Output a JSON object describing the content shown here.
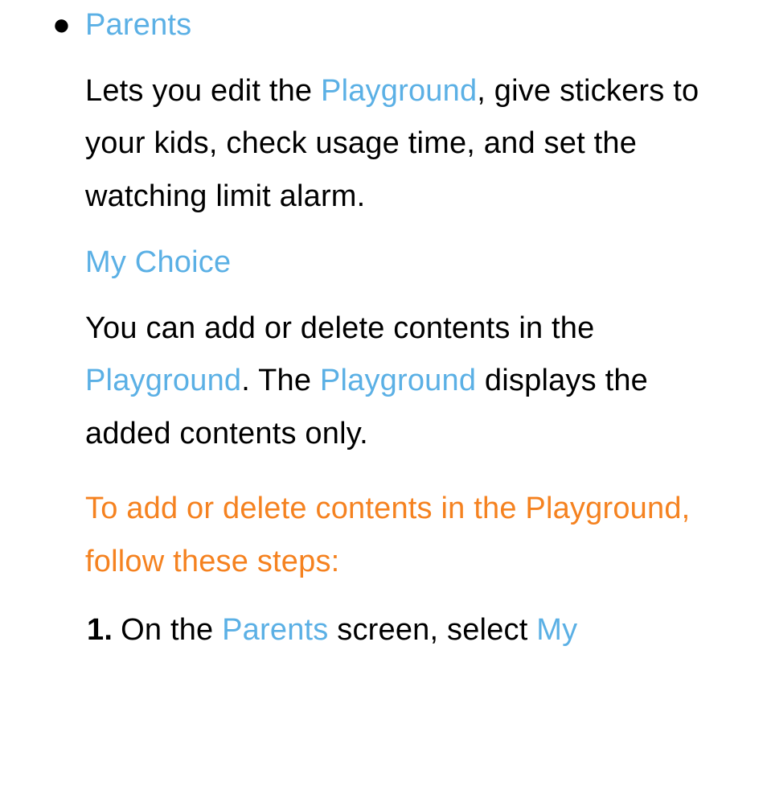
{
  "bullet": {
    "title": "Parents"
  },
  "para1": {
    "pre": "Lets you edit the ",
    "link1": "Playground",
    "post": ", give stickers to your kids, check usage time, and set the watching limit alarm."
  },
  "sectionLabel": "My Choice",
  "para2": {
    "pre": "You can add or delete contents in the ",
    "link1": "Playground",
    "mid": ". The ",
    "link2": "Playground",
    "post": " displays the added contents only."
  },
  "orange": "To add or delete contents in the Playground, follow these steps:",
  "step1": {
    "num": "1.",
    "pre": "On the ",
    "link1": "Parents",
    "mid": " screen, select ",
    "link2": "My"
  }
}
